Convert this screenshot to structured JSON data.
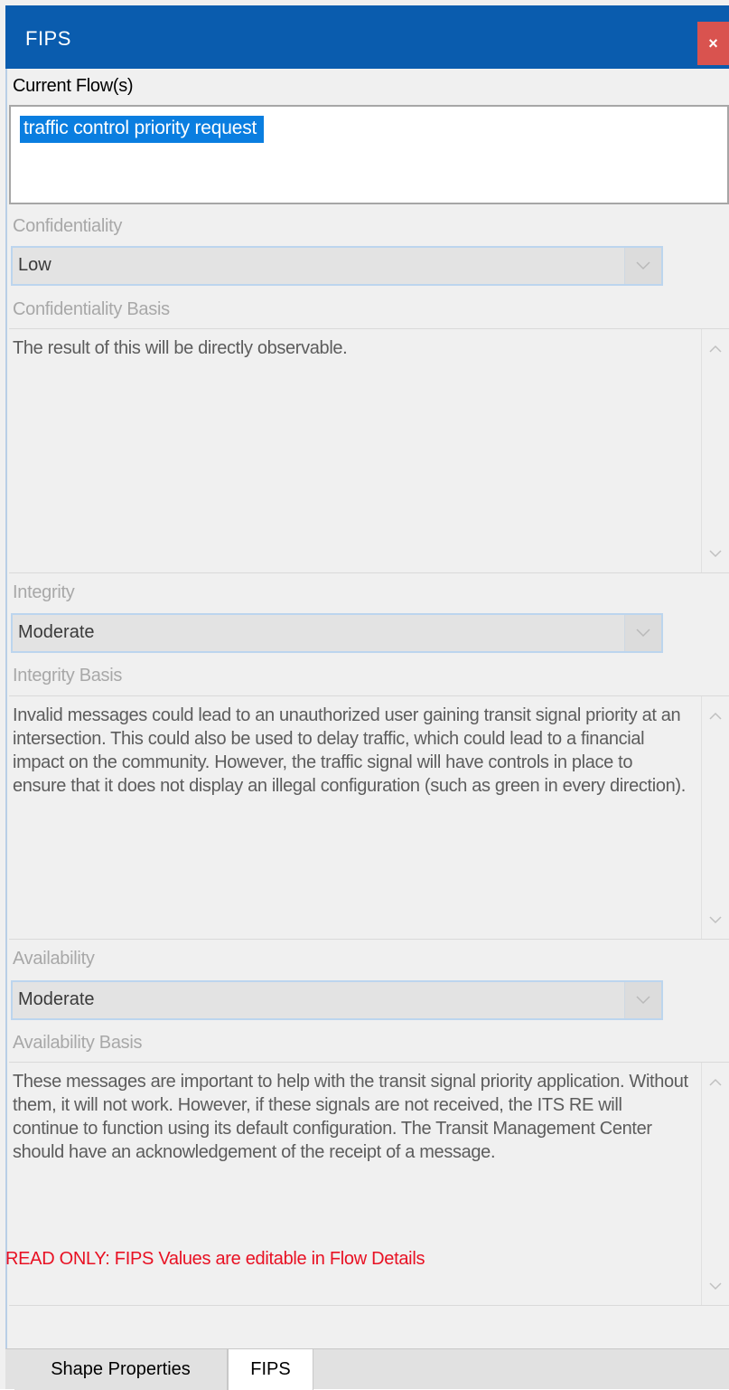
{
  "window": {
    "title": "FIPS",
    "close_label": "×"
  },
  "current_flows": {
    "label": "Current Flow(s)",
    "items": [
      "traffic control priority request"
    ]
  },
  "confidentiality": {
    "label": "Confidentiality",
    "value": "Low",
    "basis_label": "Confidentiality Basis",
    "basis_text": "The result of this will be directly observable."
  },
  "integrity": {
    "label": "Integrity",
    "value": "Moderate",
    "basis_label": "Integrity Basis",
    "basis_text": "Invalid messages could lead to an unauthorized user gaining transit signal priority at an intersection. This could also be used to delay traffic, which could lead to a financial impact on the community. However, the traffic signal will have controls in place to ensure that it does not display an illegal configuration (such as green in every direction)."
  },
  "availability": {
    "label": "Availability",
    "value": "Moderate",
    "basis_label": "Availability Basis",
    "basis_text": "These messages are important to help with the transit signal priority application. Without them, it will not work. However, if these signals are not received, the ITS RE will continue to function using its default configuration. The Transit Management Center should have an acknowledgement of the receipt of a message."
  },
  "readonly_notice": "READ ONLY: FIPS Values are editable in Flow Details",
  "tabs": [
    {
      "label": "Shape Properties",
      "active": false
    },
    {
      "label": "FIPS",
      "active": true
    }
  ],
  "icons": {
    "dropdown": "chevron-down-icon",
    "scroll_up": "chevron-up-icon",
    "scroll_down": "chevron-down-icon",
    "close": "close-icon"
  },
  "colors": {
    "titlebar": "#0a5cae",
    "close_button": "#d9534f",
    "selection": "#0a7ee0",
    "readonly_text": "#e81123"
  }
}
